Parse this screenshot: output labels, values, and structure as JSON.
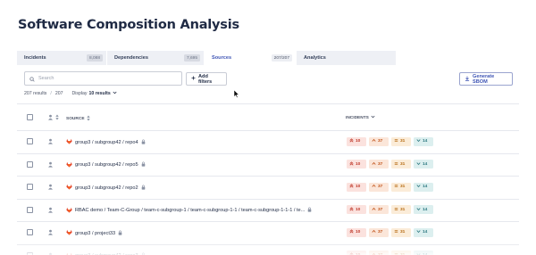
{
  "page": {
    "title": "Software Composition Analysis"
  },
  "tabs": [
    {
      "label": "Incidents",
      "count": "8,088",
      "active": false
    },
    {
      "label": "Dependencies",
      "count": "7,695",
      "active": false
    },
    {
      "label": "Sources",
      "count": "207/207",
      "active": true
    },
    {
      "label": "Analytics",
      "count": "",
      "active": false
    }
  ],
  "toolbar": {
    "search_placeholder": "Search",
    "filters_label": "Add filters",
    "sbom_label": "Generate SBOM"
  },
  "summary": {
    "results": "207 results",
    "separator": "/",
    "total": "207",
    "display_label": "Display",
    "display_value": "10 results"
  },
  "table": {
    "headers": {
      "source": "SOURCE",
      "incidents": "INCIDENTS"
    },
    "rows": [
      {
        "source": "group3 / subgroup42 / repo4",
        "critical": "10",
        "high": "37",
        "medium": "31",
        "low": "14"
      },
      {
        "source": "group3 / subgroup42 / repo5",
        "critical": "10",
        "high": "37",
        "medium": "31",
        "low": "14"
      },
      {
        "source": "group3 / subgroup42 / repo2",
        "critical": "10",
        "high": "37",
        "medium": "31",
        "low": "14"
      },
      {
        "source": "RBAC demo / Team-C-Group / team-c-subgroup-1 / team-c-subgroup-1-1 / team-c-subgroup-1-1-1 / te...",
        "critical": "10",
        "high": "37",
        "medium": "31",
        "low": "14"
      },
      {
        "source": "group3 / project33",
        "critical": "10",
        "high": "37",
        "medium": "31",
        "low": "14"
      },
      {
        "source": "group3 / subgroup42 / repo3",
        "critical": "10",
        "high": "37",
        "medium": "31",
        "low": "14"
      }
    ]
  },
  "colors": {
    "accent": "#3f55b5",
    "critical": "#c0392b",
    "high": "#c2551c",
    "medium": "#b56a12",
    "low": "#2f7a82",
    "gitlab": "#e24329"
  },
  "icons": {
    "search": "search-icon",
    "plus": "plus-icon",
    "download": "download-icon",
    "priority": "priority-icon",
    "sort": "sort-icon",
    "gitlab": "gitlab-icon",
    "lock": "lock-icon",
    "chevron": "chevron-down-icon"
  }
}
